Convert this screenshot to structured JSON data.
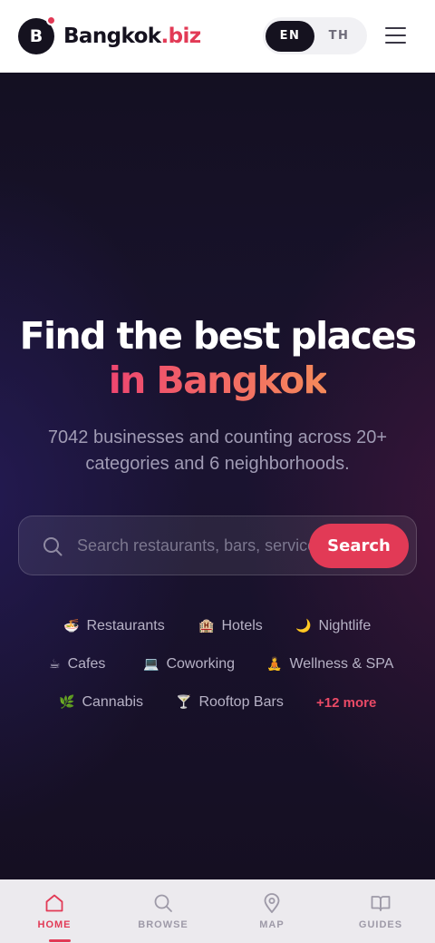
{
  "header": {
    "logo_letter": "B",
    "brand_name": "Bangkok",
    "brand_tld": ".biz",
    "languages": [
      {
        "label": "EN",
        "active": true
      },
      {
        "label": "TH",
        "active": false
      }
    ],
    "menu_icon": "hamburger-menu-icon"
  },
  "hero": {
    "title_line1": "Find the best places",
    "title_line2": "in Bangkok",
    "subtitle": "7042 businesses and counting across 20+ categories and 6 neighborhoods.",
    "search": {
      "placeholder": "Search restaurants, bars, services...",
      "button_label": "Search"
    },
    "categories": [
      {
        "emoji": "🍜",
        "label": "Restaurants"
      },
      {
        "emoji": "🏨",
        "label": "Hotels"
      },
      {
        "emoji": "🌙",
        "label": "Nightlife"
      },
      {
        "emoji": "☕",
        "label": "Cafes"
      },
      {
        "emoji": "💻",
        "label": "Coworking"
      },
      {
        "emoji": "🧘",
        "label": "Wellness & SPA"
      },
      {
        "emoji": "🌿",
        "label": "Cannabis"
      },
      {
        "emoji": "🍸",
        "label": "Rooftop Bars"
      }
    ],
    "more_label": "+12 more"
  },
  "bottom_nav": {
    "items": [
      {
        "label": "HOME",
        "icon": "home-icon",
        "active": true
      },
      {
        "label": "BROWSE",
        "icon": "search-icon",
        "active": false
      },
      {
        "label": "MAP",
        "icon": "map-pin-icon",
        "active": false
      },
      {
        "label": "GUIDES",
        "icon": "book-icon",
        "active": false
      }
    ]
  },
  "colors": {
    "accent": "#e23a56",
    "dark": "#15121f",
    "hero_bg": "#181228"
  }
}
